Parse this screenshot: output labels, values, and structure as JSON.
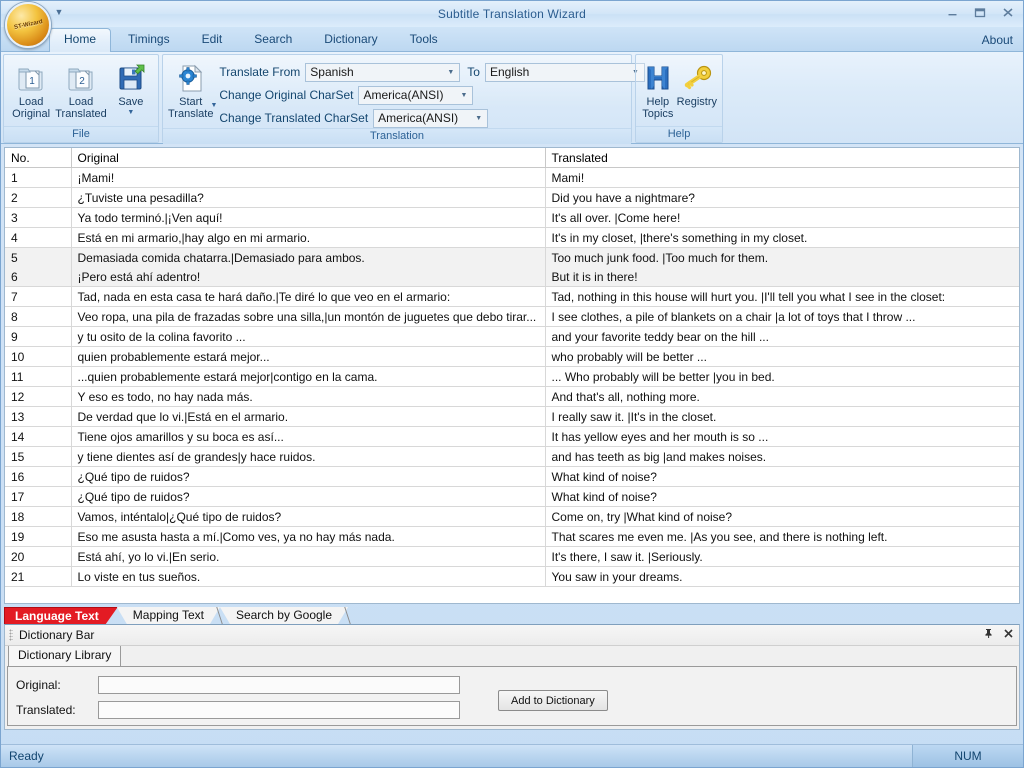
{
  "window": {
    "title": "Subtitle Translation Wizard",
    "orb_label": "ST-Wizard",
    "minimize": "—",
    "restore": "❐",
    "close": "✕"
  },
  "ribbon": {
    "tabs": [
      {
        "label": "Home",
        "active": true
      },
      {
        "label": "Timings",
        "active": false
      },
      {
        "label": "Edit",
        "active": false
      },
      {
        "label": "Search",
        "active": false
      },
      {
        "label": "Dictionary",
        "active": false
      },
      {
        "label": "Tools",
        "active": false
      }
    ],
    "about": "About",
    "groups": {
      "file": {
        "title": "File",
        "buttons": [
          {
            "label": "Load\nOriginal",
            "icon": "folder-doc-1-icon"
          },
          {
            "label": "Load\nTranslated",
            "icon": "folder-doc-2-icon"
          },
          {
            "label": "Save",
            "icon": "floppy-save-icon",
            "has_dropdown": true
          }
        ]
      },
      "translation": {
        "title": "Translation",
        "start_button": {
          "label": "Start\nTranslate",
          "icon": "page-gear-icon",
          "has_dropdown": true
        },
        "translate_from_label": "Translate From",
        "translate_from_value": "Spanish",
        "to_label": "To",
        "to_value": "English",
        "original_charset_label": "Change Original CharSet",
        "original_charset_value": "America(ANSI)",
        "translated_charset_label": "Change Translated CharSet",
        "translated_charset_value": "America(ANSI)"
      },
      "help": {
        "title": "Help",
        "buttons": [
          {
            "label": "Help\nTopics",
            "icon": "help-h-icon"
          },
          {
            "label": "Registry",
            "icon": "key-icon"
          }
        ]
      }
    }
  },
  "grid": {
    "columns": [
      "No.",
      "Original",
      "Translated"
    ],
    "rows": [
      {
        "no": "1",
        "original": "¡Mami!",
        "translated": "Mami!",
        "selected": false
      },
      {
        "no": "2",
        "original": "¿Tuviste una pesadilla?",
        "translated": "Did you have a nightmare?",
        "selected": false
      },
      {
        "no": "3",
        "original": "Ya todo terminó.|¡Ven aquí!",
        "translated": "It's all over. |Come here!",
        "selected": false
      },
      {
        "no": "4",
        "original": "Está en mi armario,|hay algo en mi armario.",
        "translated": "It's in my closet, |there's something in my closet.",
        "selected": false
      },
      {
        "no": "5",
        "original": "Demasiada comida chatarra.|Demasiado para ambos.",
        "translated": "Too much junk food. |Too much for them.",
        "selected": true
      },
      {
        "no": "6",
        "original": "¡Pero está ahí adentro!",
        "translated": "But it is in there!",
        "selected": true
      },
      {
        "no": "7",
        "original": "Tad, nada en esta casa te hará daño.|Te diré lo que veo en el armario:",
        "translated": "Tad, nothing in this house will hurt you. |I'll tell you what I see in the closet:",
        "selected": false
      },
      {
        "no": "8",
        "original": "Veo ropa, una pila de frazadas sobre una silla,|un montón de juguetes que debo tirar...",
        "translated": "I see clothes, a pile of blankets on a chair |a lot of toys that I throw ...",
        "selected": false
      },
      {
        "no": "9",
        "original": "y tu osito de la colina favorito ...",
        "translated": "and your favorite teddy bear on the hill ...",
        "selected": false
      },
      {
        "no": "10",
        "original": "quien probablemente estará mejor...",
        "translated": "who probably will be better ...",
        "selected": false
      },
      {
        "no": "11",
        "original": "...quien probablemente estará mejor|contigo en la cama.",
        "translated": "... Who probably will be better |you in bed.",
        "selected": false
      },
      {
        "no": "12",
        "original": "Y eso es todo, no hay nada más.",
        "translated": "And that's all, nothing more.",
        "selected": false
      },
      {
        "no": "13",
        "original": "De verdad que lo vi.|Está en el armario.",
        "translated": "I really saw it. |It's in the closet.",
        "selected": false
      },
      {
        "no": "14",
        "original": "Tiene ojos amarillos y su boca es así...",
        "translated": "It has yellow eyes and her mouth is so ...",
        "selected": false
      },
      {
        "no": "15",
        "original": "y tiene dientes así de grandes|y hace ruidos.",
        "translated": "and has teeth as big |and makes noises.",
        "selected": false
      },
      {
        "no": "16",
        "original": "¿Qué tipo de ruidos?",
        "translated": "What kind of noise?",
        "selected": false
      },
      {
        "no": "17",
        "original": "¿Qué tipo de ruidos?",
        "translated": "What kind of noise?",
        "selected": false
      },
      {
        "no": "18",
        "original": "Vamos, inténtalo|¿Qué tipo de ruidos?",
        "translated": "Come on, try |What kind of noise?",
        "selected": false
      },
      {
        "no": "19",
        "original": "Eso me asusta hasta a mí.|Como ves, ya no hay más nada.",
        "translated": "That scares me even me. |As you see, and there is nothing left.",
        "selected": false
      },
      {
        "no": "20",
        "original": "Está ahí, yo lo vi.|En serio.",
        "translated": "It's there, I saw it. |Seriously.",
        "selected": false
      },
      {
        "no": "21",
        "original": "Lo viste en tus sueños.",
        "translated": "You saw in your dreams.",
        "selected": false
      }
    ]
  },
  "bottom_tabs": [
    {
      "label": "Language Text",
      "active": true
    },
    {
      "label": "Mapping Text",
      "active": false
    },
    {
      "label": "Search by Google",
      "active": false
    }
  ],
  "dictionary_bar": {
    "title": "Dictionary Bar",
    "pin_icon": "pin-icon",
    "close_icon": "close-icon",
    "library_tab": "Dictionary Library",
    "original_label": "Original:",
    "original_value": "",
    "translated_label": "Translated:",
    "translated_value": "",
    "add_button": "Add to Dictionary"
  },
  "statusbar": {
    "message": "Ready",
    "num": "NUM"
  },
  "colors": {
    "accent_tab_red": "#e31b23",
    "titlebar_text": "#2c5d8f",
    "ribbon_label": "#14466f"
  }
}
